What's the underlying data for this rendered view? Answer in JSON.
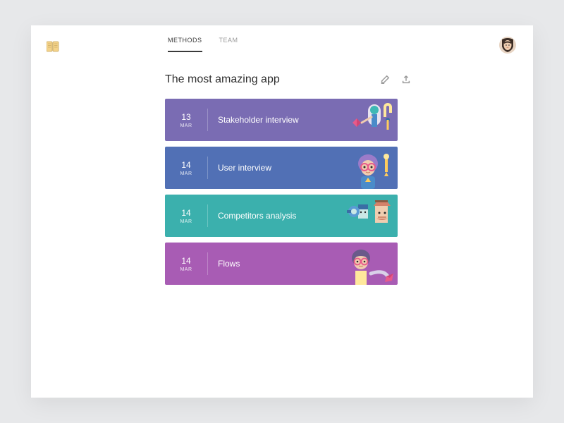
{
  "nav": {
    "tabs": [
      "METHODS",
      "TEAM"
    ],
    "active": 0
  },
  "page": {
    "title": "The most amazing app"
  },
  "cards": [
    {
      "day": "13",
      "month": "MAR",
      "title": "Stakeholder interview",
      "color": "c-purple",
      "illus": "stakeholder"
    },
    {
      "day": "14",
      "month": "MAR",
      "title": "User interview",
      "color": "c-blue",
      "illus": "user"
    },
    {
      "day": "14",
      "month": "MAR",
      "title": "Competitors analysis",
      "color": "c-teal",
      "illus": "competitors"
    },
    {
      "day": "14",
      "month": "MAR",
      "title": "Flows",
      "color": "c-magenta",
      "illus": "flows"
    }
  ]
}
